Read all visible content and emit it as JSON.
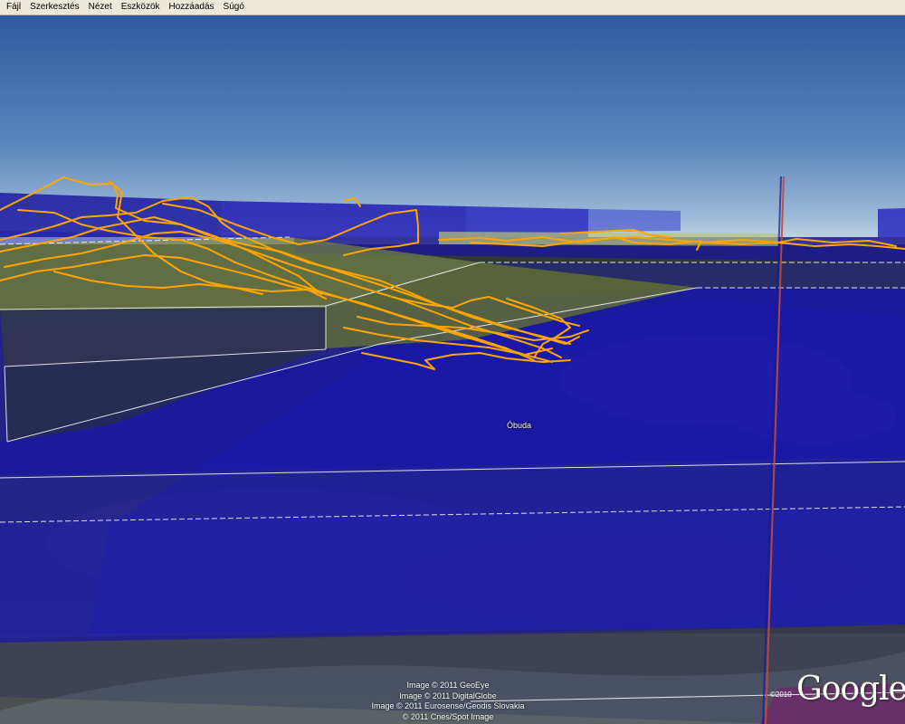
{
  "menu": [
    "Fájl",
    "Szerkesztés",
    "Nézet",
    "Eszközök",
    "Hozzáadás",
    "Súgó"
  ],
  "map": {
    "place_label": "Óbuda",
    "imagery_credits": [
      "Image © 2011 GeoEye",
      "Image © 2011 DigitalGlobe",
      "Image © 2011 Eurosense/Geodis Slovakia",
      "© 2011 Cnes/Spot Image"
    ],
    "copyright": "©2010",
    "logo": "Google"
  },
  "colors": {
    "track": "#ffa500",
    "airspace_fill": "#1a1aa8",
    "airspace_green": "#8a9a2a",
    "sky_top": "#3a5fa5",
    "sky_horizon": "#c9d8e6"
  }
}
